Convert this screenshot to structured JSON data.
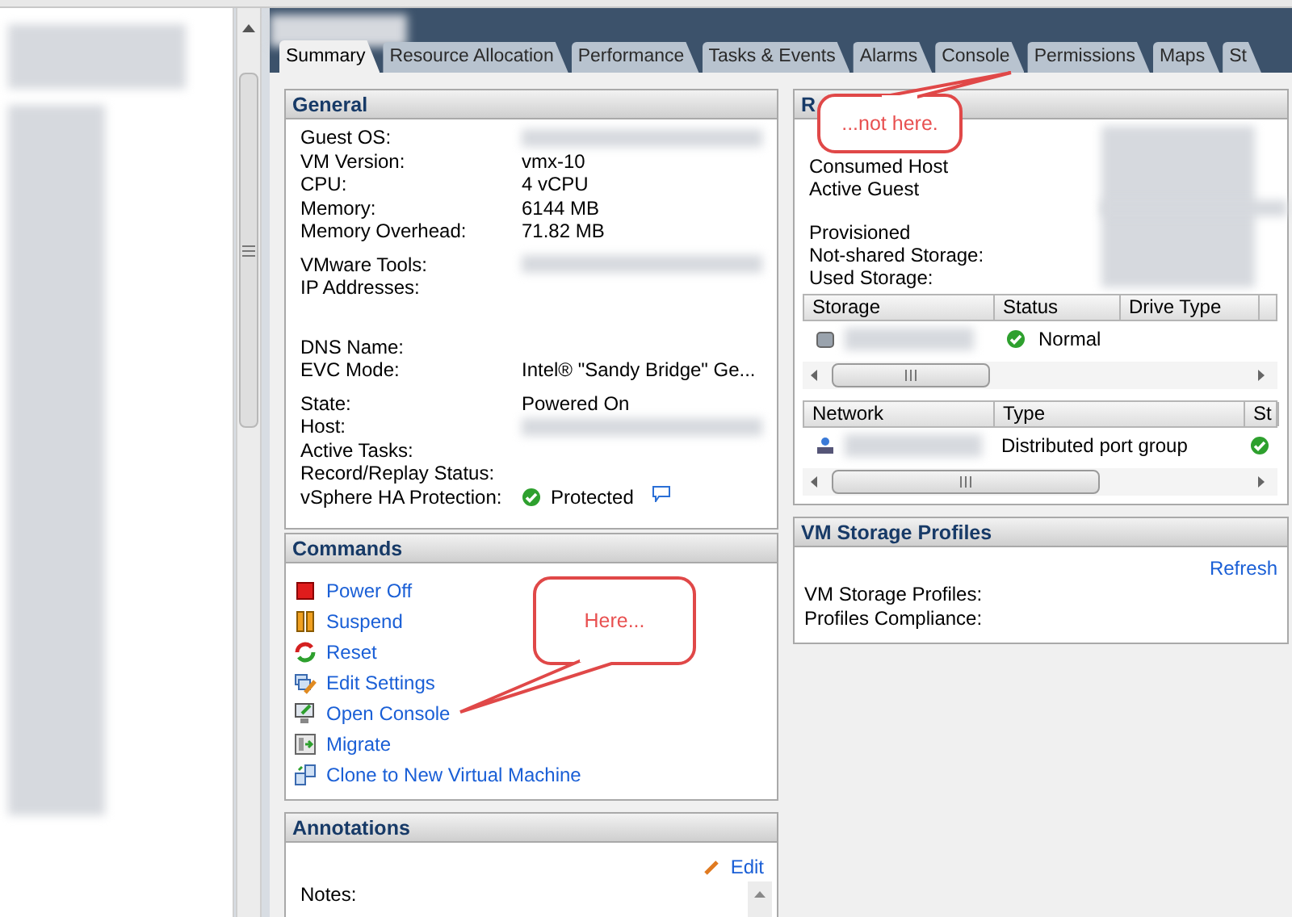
{
  "tabs": [
    {
      "label": "Summary",
      "selected": true
    },
    {
      "label": "Resource Allocation",
      "selected": false
    },
    {
      "label": "Performance",
      "selected": false
    },
    {
      "label": "Tasks & Events",
      "selected": false
    },
    {
      "label": "Alarms",
      "selected": false
    },
    {
      "label": "Console",
      "selected": false
    },
    {
      "label": "Permissions",
      "selected": false
    },
    {
      "label": "Maps",
      "selected": false
    },
    {
      "label": "St",
      "selected": false
    }
  ],
  "general": {
    "title": "General",
    "groups": [
      [
        {
          "label": "Guest OS:",
          "kind": "redacted"
        },
        {
          "label": "VM Version:",
          "value": "vmx-10"
        },
        {
          "label": "CPU:",
          "value": "4 vCPU"
        },
        {
          "label": "Memory:",
          "value": "6144 MB"
        },
        {
          "label": "Memory Overhead:",
          "value": "71.82 MB"
        }
      ],
      [
        {
          "label": "VMware Tools:",
          "kind": "redacted"
        },
        {
          "label": "IP Addresses:",
          "kind": "blank"
        }
      ],
      [
        {
          "label": "DNS Name:"
        },
        {
          "label": "EVC Mode:",
          "value": "Intel® \"Sandy Bridge\" Ge..."
        }
      ],
      [
        {
          "label": "State:",
          "value": "Powered On"
        },
        {
          "label": "Host:",
          "kind": "redacted"
        },
        {
          "label": "Active Tasks:"
        },
        {
          "label": "Record/Replay Status:"
        },
        {
          "label": "vSphere HA Protection:",
          "value": "Protected",
          "kind": "status"
        }
      ]
    ]
  },
  "commands": {
    "title": "Commands",
    "items": [
      {
        "label": "Power Off",
        "kind": "power-off"
      },
      {
        "label": "Suspend",
        "kind": "suspend"
      },
      {
        "label": "Reset",
        "kind": "reset"
      },
      {
        "label": "Edit Settings",
        "kind": "edit"
      },
      {
        "label": "Open Console",
        "kind": "console"
      },
      {
        "label": "Migrate",
        "kind": "migrate"
      },
      {
        "label": "Clone to New Virtual Machine",
        "kind": "clone"
      }
    ]
  },
  "annotations": {
    "title": "Annotations",
    "edit": "Edit",
    "notes_label": "Notes:"
  },
  "resources": {
    "title": "R",
    "labels": [
      [
        "Consumed Host",
        "Active Guest"
      ],
      [
        "Provisioned",
        "Not-shared Storage:",
        "Used Storage:"
      ]
    ],
    "storage_table": {
      "columns": [
        "Storage",
        "Status",
        "Drive Type"
      ],
      "rows": [
        {
          "status": "Normal"
        }
      ]
    },
    "network_table": {
      "columns": [
        "Network",
        "Type",
        "St"
      ],
      "rows": [
        {
          "type": "Distributed port group"
        }
      ]
    }
  },
  "storage_profiles": {
    "title": "VM Storage Profiles",
    "refresh": "Refresh",
    "labels": [
      "VM Storage Profiles:",
      "Profiles Compliance:"
    ]
  },
  "callouts": [
    {
      "text": "...not here."
    },
    {
      "text": "Here..."
    }
  ]
}
